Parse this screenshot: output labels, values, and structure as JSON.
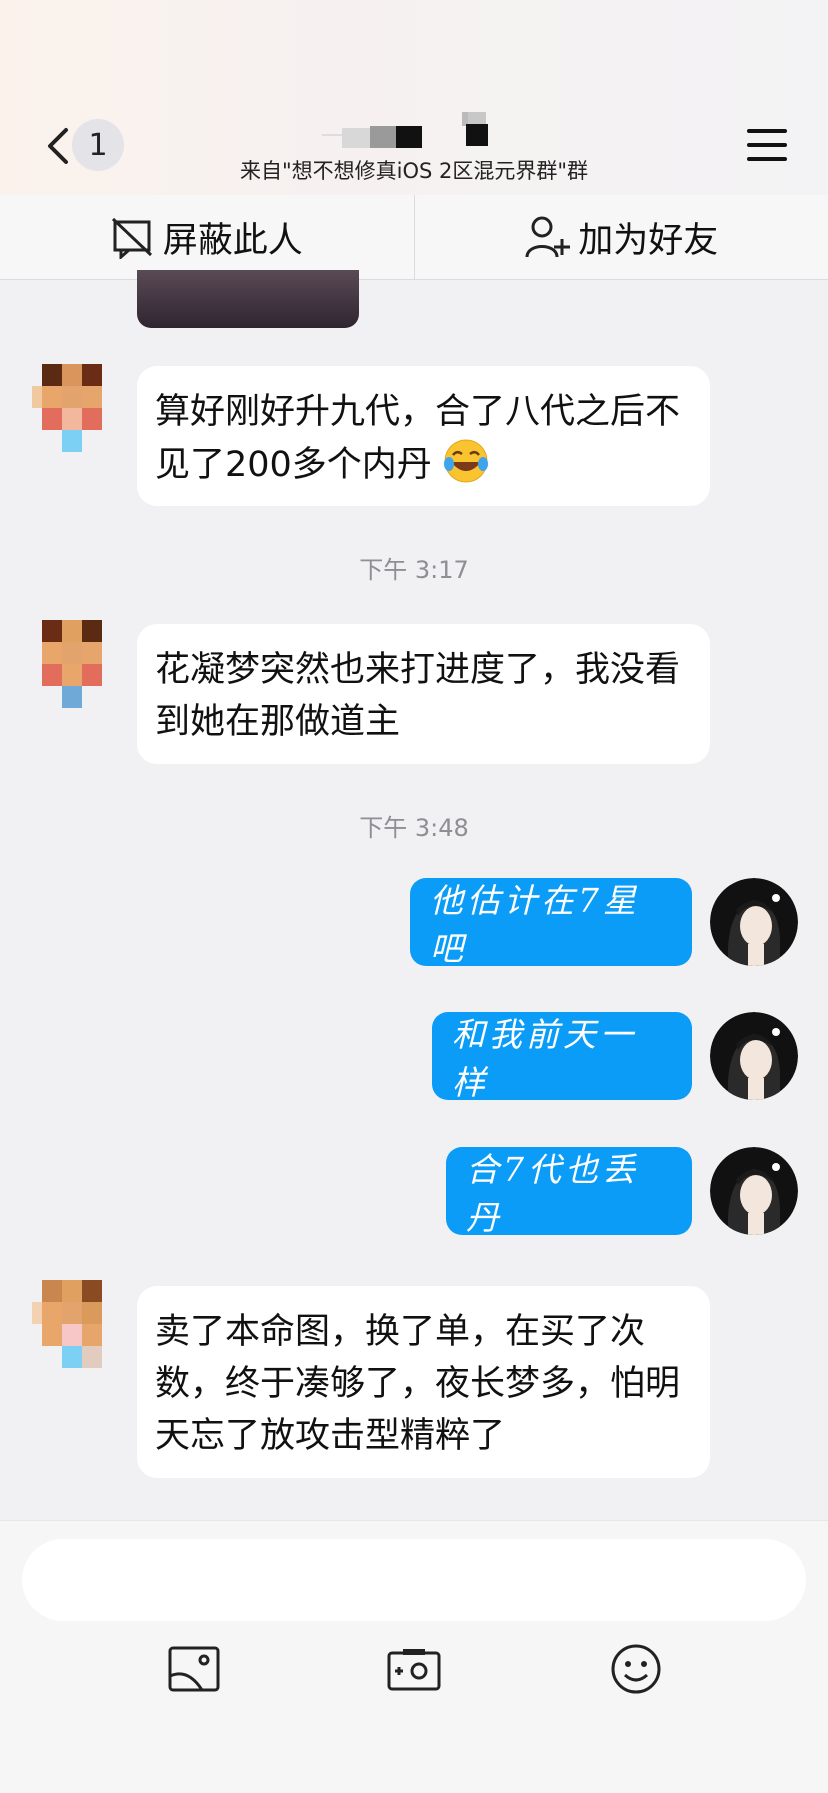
{
  "header": {
    "back_count": "1",
    "subtitle": "来自\"想不想修真iOS 2区混元界群\"群"
  },
  "actions": {
    "block": "屏蔽此人",
    "add_friend": "加为好友"
  },
  "messages": [
    {
      "side": "left",
      "text": "算好刚好升九代，合了八代之后不见了200多个内丹"
    },
    {
      "side": "time",
      "text": "下午 3:17"
    },
    {
      "side": "left",
      "text": "花凝梦突然也来打进度了，我没看到她在那做道主"
    },
    {
      "side": "time",
      "text": "下午 3:48"
    },
    {
      "side": "right",
      "text": "他估计在7星吧"
    },
    {
      "side": "right",
      "text": "和我前天一样"
    },
    {
      "side": "right",
      "text": "合7代也丢丹"
    },
    {
      "side": "left",
      "text": "卖了本命图，换了单，在买了次数，终于凑够了，夜长梦多，怕明天忘了放攻击型精粹了"
    }
  ],
  "icons": {
    "back": "chevron-left-icon",
    "menu": "hamburger-menu-icon",
    "block": "block-user-icon",
    "add_friend": "add-user-icon",
    "emoji": "laughing-crying-emoji",
    "toolbar": [
      "image-icon",
      "camera-icon",
      "emoji-icon"
    ]
  },
  "colors": {
    "bubble_right": "#0a9cf7",
    "bubble_left": "#ffffff",
    "background": "#f1f1f3"
  }
}
